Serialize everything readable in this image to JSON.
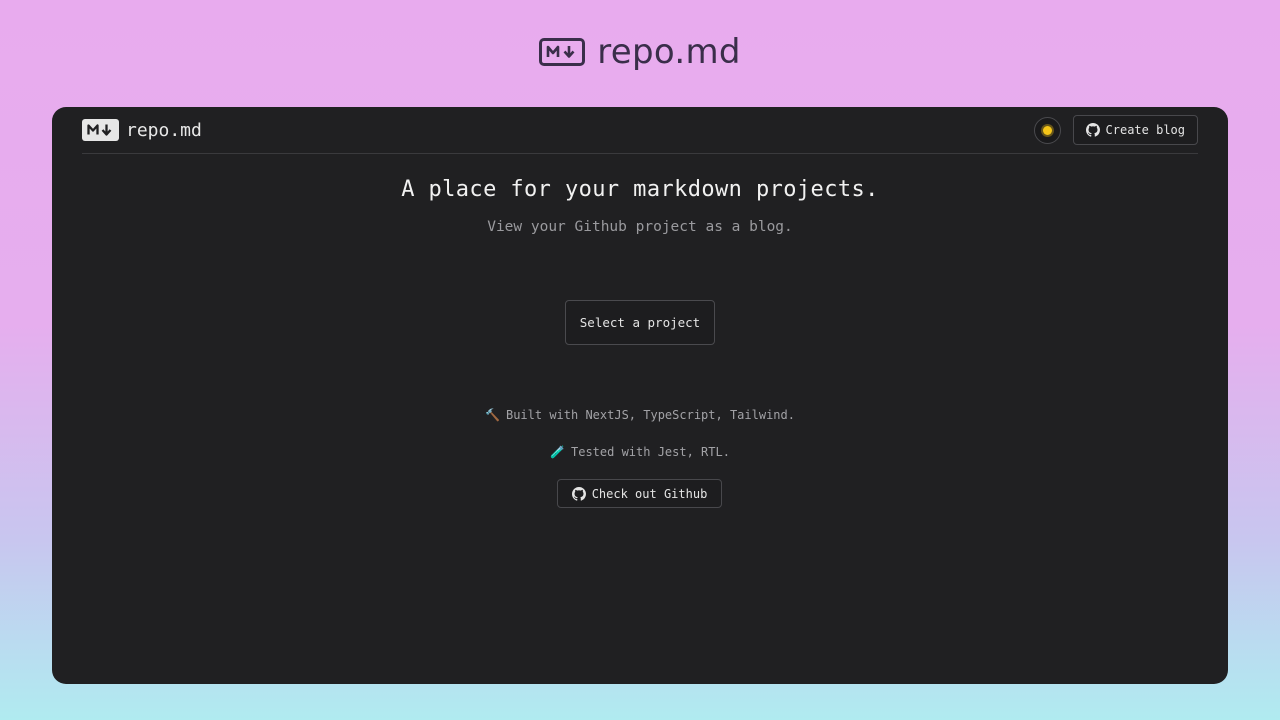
{
  "brand": {
    "name": "repo.md"
  },
  "header": {
    "logo_text": "repo.md",
    "create_blog_label": "Create blog"
  },
  "hero": {
    "title": "A place for your markdown projects.",
    "subtitle": "View your Github project as a blog."
  },
  "actions": {
    "select_project_label": "Select a project"
  },
  "features": [
    {
      "emoji": "🔨",
      "text": "Built with NextJS, TypeScript, Tailwind."
    },
    {
      "emoji": "🧪",
      "text": "Tested with Jest, RTL."
    }
  ],
  "github_button_label": "Check out Github",
  "colors": {
    "window_bg": "#202022",
    "accent_sun": "#f5c518",
    "text_primary": "#f1f1f1",
    "text_muted": "#9a9a9e"
  }
}
